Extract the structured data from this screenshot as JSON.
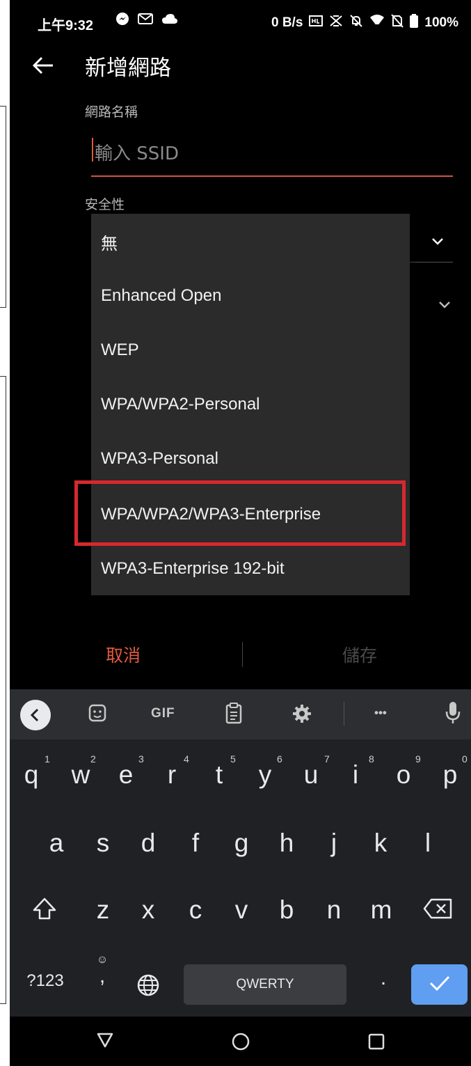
{
  "status_bar": {
    "time": "上午9:32",
    "net_speed": "0 B/s",
    "battery": "100%"
  },
  "app_bar": {
    "title": "新增網路"
  },
  "form": {
    "network_name_label": "網路名稱",
    "ssid_placeholder": "輸入 SSID",
    "security_label": "安全性"
  },
  "security_dropdown": {
    "options": [
      "無",
      "Enhanced Open",
      "WEP",
      "WPA/WPA2-Personal",
      "WPA3-Personal",
      "WPA/WPA2/WPA3-Enterprise",
      "WPA3-Enterprise 192-bit"
    ],
    "highlighted_option": "WPA/WPA2/WPA3-Enterprise"
  },
  "dialog_buttons": {
    "cancel": "取消",
    "save": "儲存"
  },
  "keyboard": {
    "toolbar": {
      "gif": "GIF",
      "more": "•••"
    },
    "row1": [
      "q",
      "w",
      "e",
      "r",
      "t",
      "y",
      "u",
      "i",
      "o",
      "p"
    ],
    "row1_hints": [
      "1",
      "2",
      "3",
      "4",
      "5",
      "6",
      "7",
      "8",
      "9",
      "0"
    ],
    "row2": [
      "a",
      "s",
      "d",
      "f",
      "g",
      "h",
      "j",
      "k",
      "l"
    ],
    "row3": [
      "z",
      "x",
      "c",
      "v",
      "b",
      "n",
      "m"
    ],
    "symbols_key": "?123",
    "comma_key": ",",
    "period_key": ".",
    "space_label": "QWERTY"
  },
  "colors": {
    "accent": "#e05a3e",
    "highlight_box": "#d7282f",
    "enter_key": "#5f9ef0",
    "dropdown_bg": "#2b2b2b",
    "keyboard_bg": "#202124"
  }
}
